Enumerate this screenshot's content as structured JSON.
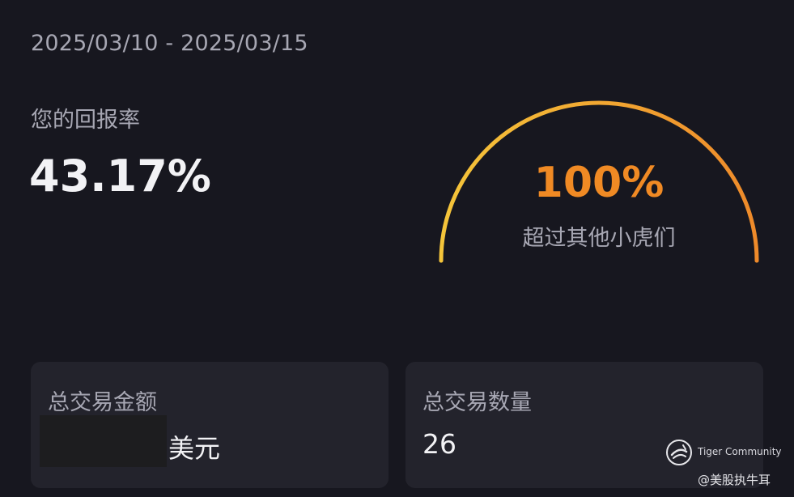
{
  "date_range": "2025/03/10 - 2025/03/15",
  "return": {
    "label": "您的回报率",
    "value": "43.17%"
  },
  "gauge": {
    "percent_text": "100%",
    "percent_value": 1.0,
    "label": "超过其他小虎们",
    "colors": {
      "start": "#f5c53a",
      "end": "#ee8a2a",
      "text": "#f08a24"
    }
  },
  "cards": [
    {
      "label": "总交易金额",
      "value_redacted": true,
      "unit": "美元"
    },
    {
      "label": "总交易数量",
      "value": "26"
    }
  ],
  "watermark": {
    "brand": "Tiger Community",
    "handle": "@美股执牛耳",
    "icon": "tiger-community-logo-icon"
  },
  "colors": {
    "background": "#17171f",
    "card": "#23232c",
    "muted_text": "#a7a7b3",
    "primary_text": "#f2f2f5"
  }
}
